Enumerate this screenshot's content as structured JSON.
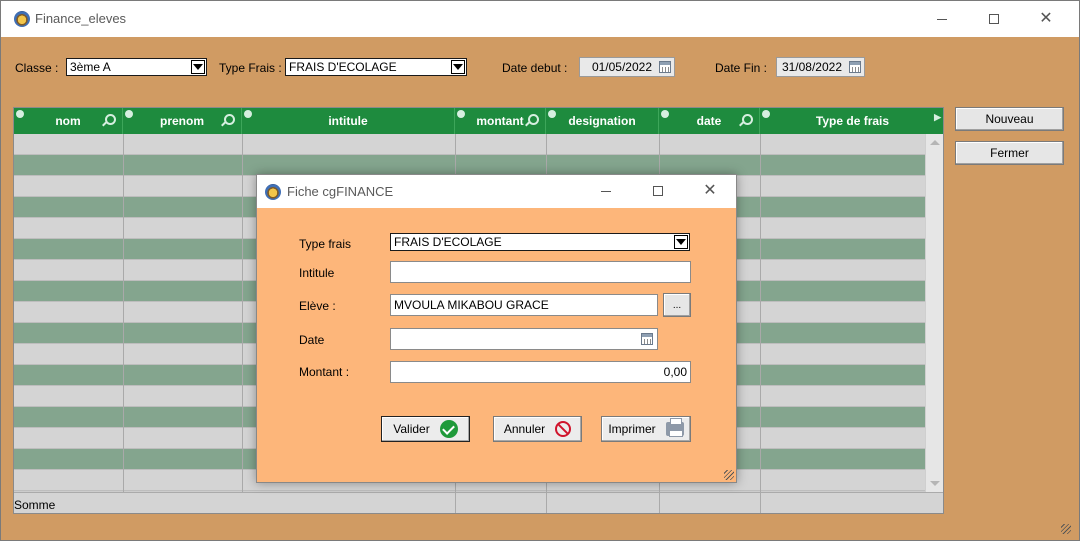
{
  "window": {
    "title": "Finance_eleves",
    "icon": "app-icon"
  },
  "filters": {
    "classe_label": "Classe :",
    "classe_value": "3ème A",
    "type_frais_label": "Type Frais :",
    "type_frais_value": "FRAIS D'ECOLAGE",
    "date_debut_label": "Date debut :",
    "date_debut_value": "01/05/2022",
    "date_fin_label": "Date Fin :",
    "date_fin_value": "31/08/2022"
  },
  "grid": {
    "columns": [
      "nom",
      "prenom",
      "intitule",
      "montant",
      "designation",
      "date",
      "Type de frais"
    ],
    "footer_label": "Somme",
    "header_color": "#1e8b3e",
    "row_colors": [
      "#d4d4d4",
      "#84a58e"
    ]
  },
  "side_buttons": {
    "nouveau": "Nouveau",
    "fermer": "Fermer"
  },
  "dialog": {
    "title": "Fiche cgFINANCE",
    "type_frais_label": "Type frais",
    "type_frais_value": "FRAIS D'ECOLAGE",
    "intitule_label": "Intitule",
    "intitule_value": "",
    "eleve_label": "Elève :",
    "eleve_value": "MVOULA MIKABOU GRACE",
    "eleve_browse": "...",
    "date_label": "Date",
    "date_value": "",
    "montant_label": "Montant :",
    "montant_value": "0,00",
    "valider": "Valider",
    "annuler": "Annuler",
    "imprimer": "Imprimer",
    "background_color": "#fdb67a"
  }
}
